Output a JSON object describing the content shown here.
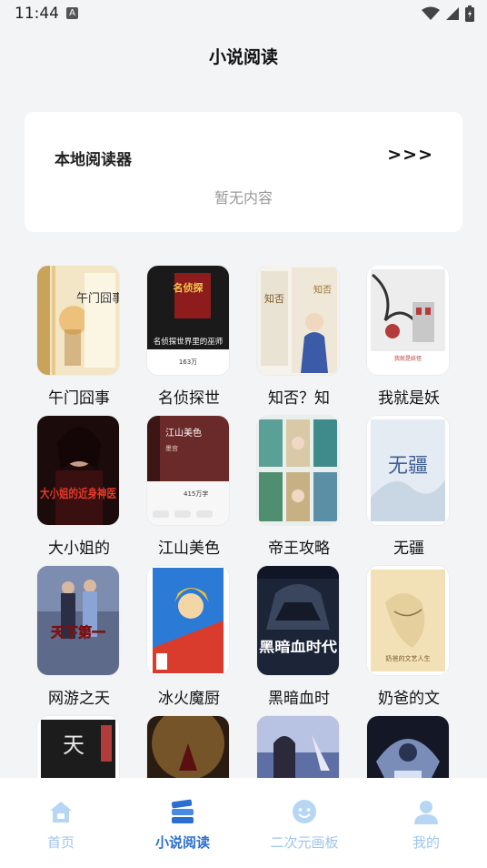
{
  "status": {
    "time": "11:44"
  },
  "header": {
    "title": "小说阅读"
  },
  "reader": {
    "title": "本地阅读器",
    "more": ">>>",
    "empty": "暂无内容"
  },
  "books": [
    {
      "title": "午门囧事"
    },
    {
      "title": "名侦探世"
    },
    {
      "title": "知否？知"
    },
    {
      "title": "我就是妖"
    },
    {
      "title": "大小姐的"
    },
    {
      "title": "江山美色"
    },
    {
      "title": "帝王攻略"
    },
    {
      "title": "无疆"
    },
    {
      "title": "网游之天"
    },
    {
      "title": "冰火魔厨"
    },
    {
      "title": "黑暗血时"
    },
    {
      "title": "奶爸的文"
    }
  ],
  "covers": {
    "c1": "午门囧事",
    "c2a": "名侦探世界里的巫师",
    "c2b": "163万",
    "c5": "大小姐的近身神医",
    "c6a": "江山美色",
    "c6b": "415万字",
    "c8": "无疆",
    "c9": "天下第一",
    "c11": "黑暗血时代"
  },
  "nav": [
    {
      "label": "首页",
      "icon": "home-icon"
    },
    {
      "label": "小说阅读",
      "icon": "books-icon"
    },
    {
      "label": "二次元画板",
      "icon": "face-icon"
    },
    {
      "label": "我的",
      "icon": "person-icon"
    }
  ],
  "colors": {
    "accent": "#2b6fce",
    "navInactive": "#9dc5ee"
  }
}
